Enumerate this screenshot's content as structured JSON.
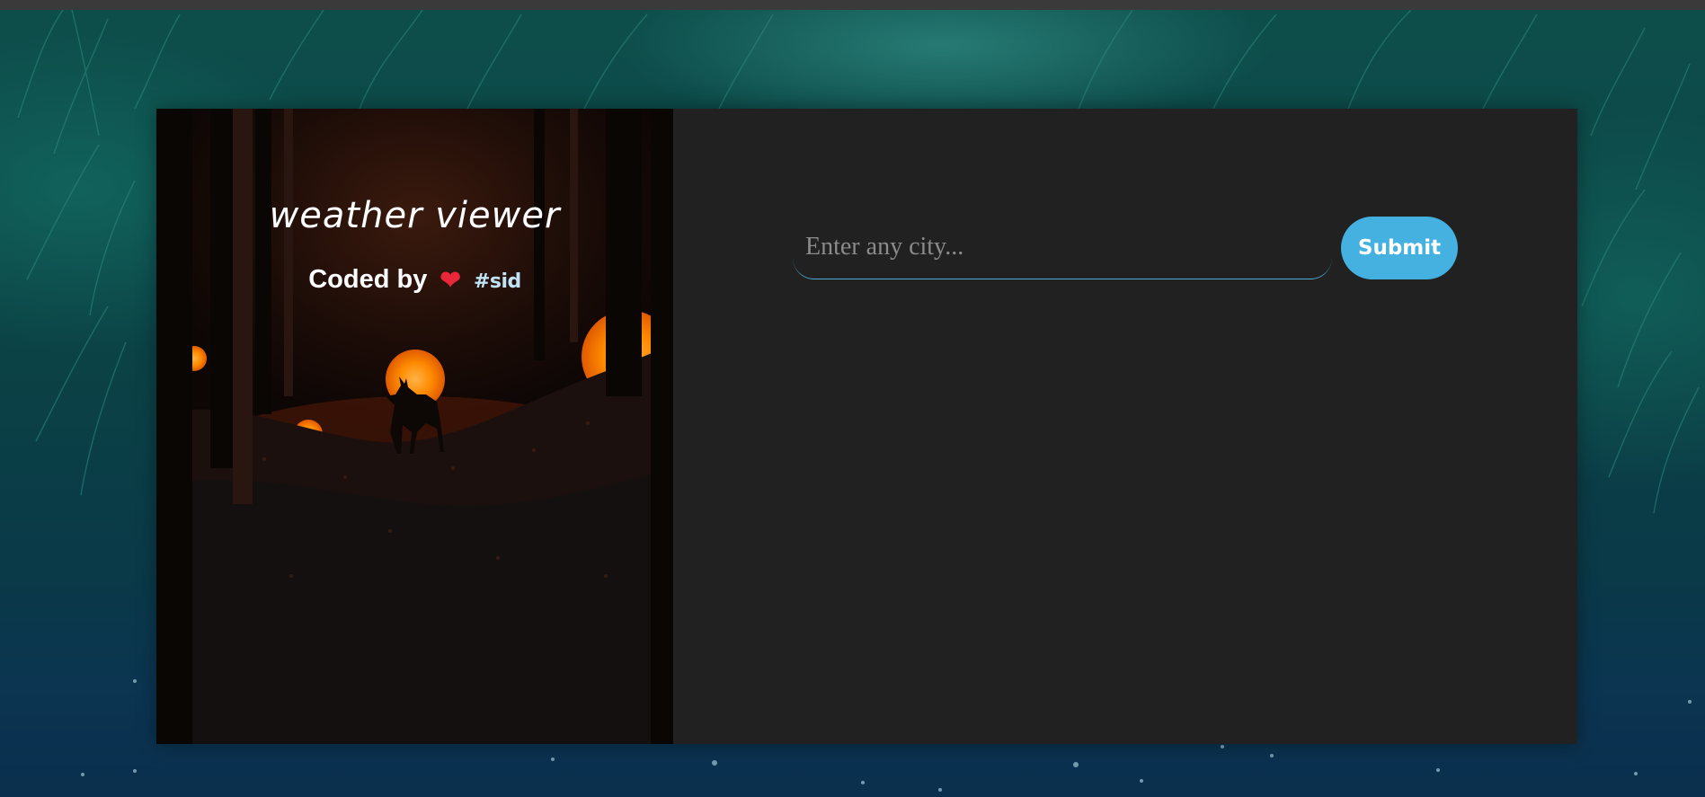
{
  "app": {
    "title": "weather viewer",
    "credit_prefix": "Coded by",
    "credit_heart": "❤",
    "credit_author": "#sid"
  },
  "search": {
    "placeholder": "Enter any city...",
    "value": "",
    "submit_label": "Submit"
  },
  "colors": {
    "accent": "#44b1e0",
    "panel": "#212121",
    "heart": "#e8283a"
  }
}
